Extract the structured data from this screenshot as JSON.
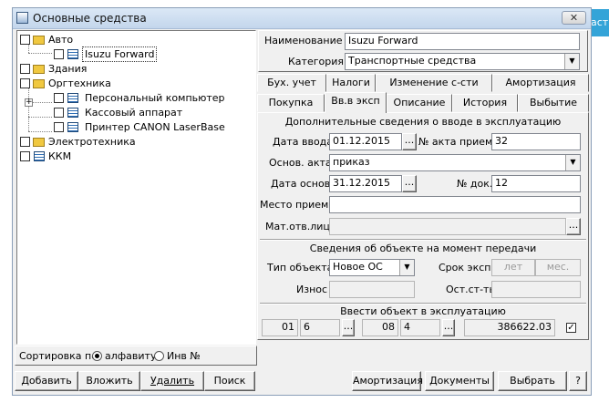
{
  "window": {
    "title": "Основные средства",
    "close_label": "✕",
    "bg_edge_text": "аст"
  },
  "tree": {
    "items": [
      {
        "label": "Авто",
        "type": "folder"
      },
      {
        "label": "Isuzu Forward",
        "type": "item"
      },
      {
        "label": "Здания",
        "type": "folder"
      },
      {
        "label": "Оргтехника",
        "type": "folder"
      },
      {
        "label": "Персональный компьютер",
        "type": "item"
      },
      {
        "label": "Кассовый аппарат",
        "type": "item"
      },
      {
        "label": "Принтер CANON LaserBase",
        "type": "item"
      },
      {
        "label": "Электротехника",
        "type": "folder"
      },
      {
        "label": "ККМ",
        "type": "item"
      }
    ]
  },
  "sort": {
    "label": "Сортировка по",
    "option1": "алфавиту",
    "option2": "Инв №",
    "selected": "алфавиту"
  },
  "left_buttons": {
    "add": "Добавить",
    "insert": "Вложить",
    "delete": "Удалить",
    "search": "Поиск"
  },
  "header": {
    "name_label": "Наименование",
    "name_value": "Isuzu Forward",
    "category_label": "Категория",
    "category_value": "Транспортные средства"
  },
  "tabs_row1": [
    "Бух. учет",
    "Налоги",
    "Изменение с-сти",
    "Амортизация"
  ],
  "tabs_row2": [
    "Покупка",
    "Вв.в эксп",
    "Описание",
    "История",
    "Выбытие"
  ],
  "intro": {
    "title": "Дополнительные сведения о вводе в эксплуатацию",
    "date_label": "Дата ввода",
    "date_value": "01.12.2015",
    "act_no_label": "№ акта приема",
    "act_no_value": "32",
    "basis_label": "Основ. акта",
    "basis_value": "приказ",
    "basis_date_label": "Дата основ.",
    "basis_date_value": "31.12.2015",
    "doc_no_label": "№ док.",
    "doc_no_value": "12",
    "place_label": "Место приема",
    "place_value": "",
    "resp_label": "Мат.отв.лицо",
    "resp_value": ""
  },
  "transfer": {
    "title": "Сведения об объекте на момент передачи",
    "type_label": "Тип объекта",
    "type_value": "Новое ОС",
    "term_label": "Срок эксп.",
    "years_ph": "лет",
    "months_ph": "мес.",
    "wear_label": "Износ",
    "residual_label": "Ост.ст-ть"
  },
  "commission": {
    "title": "Ввести объект в эксплуатацию",
    "f1": "01",
    "f2": "6",
    "f3": "08",
    "f4": "4",
    "amount": "386622.03",
    "checked": true
  },
  "right_buttons": {
    "amort": "Амортизация",
    "docs": "Документы",
    "select": "Выбрать",
    "help": "?"
  },
  "ellipsis": "..."
}
